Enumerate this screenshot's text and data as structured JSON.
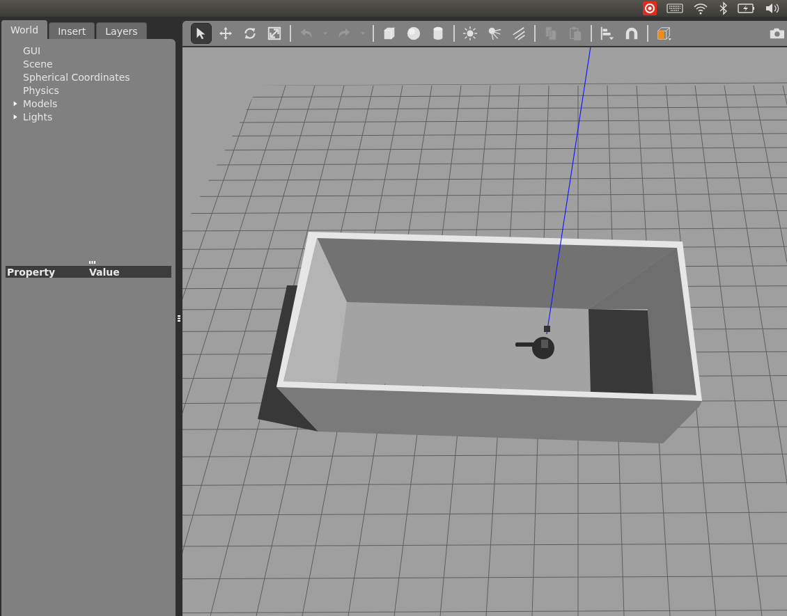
{
  "system_bar": {
    "indicators": [
      {
        "kind": "app"
      },
      {
        "kind": "keyboard"
      },
      {
        "kind": "wifi"
      },
      {
        "kind": "bluetooth"
      },
      {
        "kind": "battery"
      },
      {
        "kind": "volume"
      }
    ]
  },
  "tabs": [
    {
      "label": "World",
      "selected": true
    },
    {
      "label": "Insert",
      "selected": false
    },
    {
      "label": "Layers",
      "selected": false
    }
  ],
  "tree": [
    {
      "label": "GUI",
      "kind": "leaf"
    },
    {
      "label": "Scene",
      "kind": "leaf"
    },
    {
      "label": "Spherical Coordinates",
      "kind": "leaf"
    },
    {
      "label": "Physics",
      "kind": "leaf"
    },
    {
      "label": "Models",
      "kind": "group",
      "expanded": false
    },
    {
      "label": "Lights",
      "kind": "group",
      "expanded": false
    }
  ],
  "property_table": {
    "columns": [
      "Property",
      "Value"
    ]
  },
  "toolbar": [
    {
      "tools": [
        {
          "kind": "select",
          "selected": true,
          "disabled": false
        },
        {
          "kind": "translate",
          "selected": false,
          "disabled": false
        },
        {
          "kind": "rotate",
          "selected": false,
          "disabled": false
        },
        {
          "kind": "scale",
          "selected": false,
          "disabled": false
        }
      ]
    },
    {
      "tools": [
        {
          "kind": "undo",
          "disabled": true
        },
        {
          "kind": "dropdown",
          "disabled": true
        },
        {
          "kind": "redo",
          "disabled": true
        },
        {
          "kind": "dropdown",
          "disabled": true
        }
      ]
    },
    {
      "tools": [
        {
          "kind": "box",
          "disabled": false
        },
        {
          "kind": "sphere",
          "disabled": false
        },
        {
          "kind": "cylinder",
          "disabled": false
        }
      ]
    },
    {
      "tools": [
        {
          "kind": "point-light",
          "disabled": false
        },
        {
          "kind": "spot-light",
          "disabled": false
        },
        {
          "kind": "directional-light",
          "disabled": false
        }
      ]
    },
    {
      "tools": [
        {
          "kind": "copy",
          "disabled": true
        },
        {
          "kind": "paste",
          "disabled": true
        }
      ]
    },
    {
      "tools": [
        {
          "kind": "align",
          "disabled": false
        },
        {
          "kind": "snap",
          "disabled": false
        }
      ]
    },
    {
      "tools": [
        {
          "kind": "view-angle",
          "disabled": false
        }
      ]
    }
  ],
  "toolbar_right": [
    {
      "kind": "camera",
      "disabled": false
    }
  ]
}
